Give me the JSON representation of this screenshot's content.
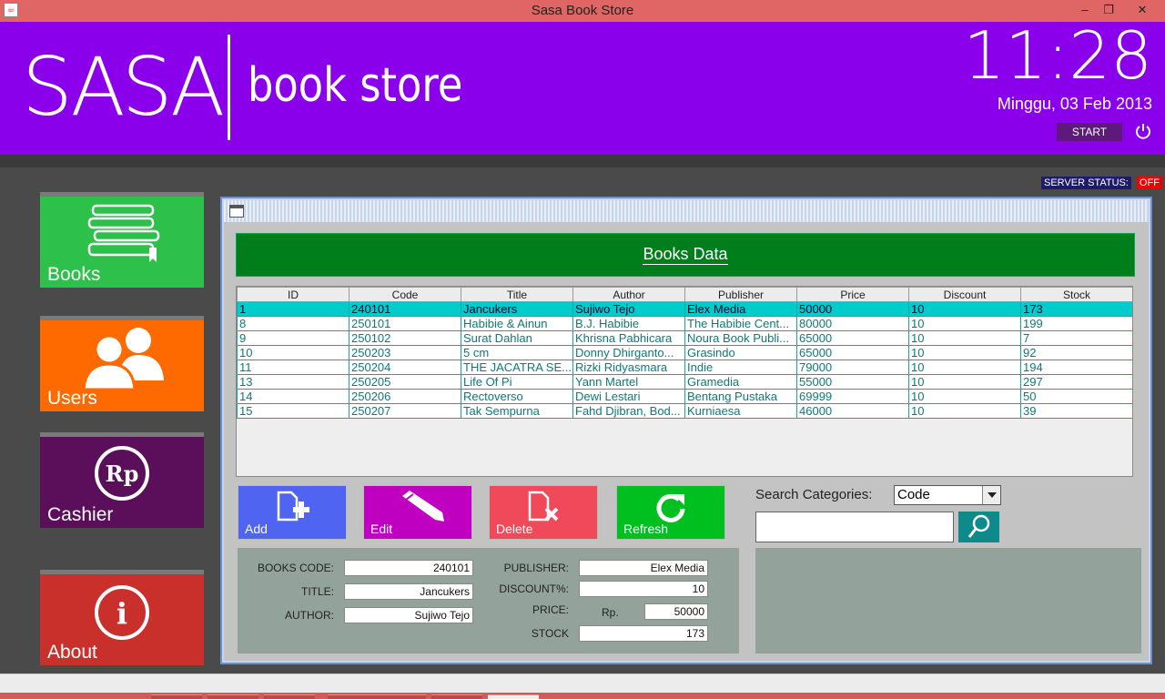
{
  "window": {
    "title": "Sasa Book Store",
    "controls": [
      "–",
      "❐",
      "✕"
    ]
  },
  "header": {
    "logo_main": "SASA",
    "logo_sub": "book store",
    "clock": "11:28",
    "date": "Minggu, 03 Feb 2013",
    "start_label": "START"
  },
  "server": {
    "label": "SERVER STATUS:",
    "value": "OFF"
  },
  "sidebar": {
    "items": [
      {
        "label": "Books",
        "color": "#2dc04a"
      },
      {
        "label": "Users",
        "color": "#ff6a00"
      },
      {
        "label": "Cashier",
        "color": "#5b0f5b",
        "icon_text": "Rp"
      },
      {
        "label": "About",
        "color": "#c9302c",
        "icon_text": "i"
      }
    ]
  },
  "panel": {
    "title": "Books Data"
  },
  "table": {
    "columns": [
      "ID",
      "Code",
      "Title",
      "Author",
      "Publisher",
      "Price",
      "Discount",
      "Stock"
    ],
    "rows": [
      [
        "1",
        "240101",
        "Jancukers",
        "Sujiwo Tejo",
        "Elex Media",
        "50000",
        "10",
        "173"
      ],
      [
        "8",
        "250101",
        "Habibie & Ainun",
        "B.J. Habibie",
        "The Habibie Cent...",
        "80000",
        "10",
        "199"
      ],
      [
        "9",
        "250102",
        "Surat Dahlan",
        "Khrisna Pabhicara",
        "Noura Book Publi...",
        "65000",
        "10",
        "7"
      ],
      [
        "10",
        "250203",
        "5 cm",
        "Donny Dhirganto...",
        "Grasindo",
        "65000",
        "10",
        "92"
      ],
      [
        "11",
        "250204",
        "THE JACATRA SE...",
        "Rizki Ridyasmara",
        "Indie",
        "79000",
        "10",
        "194"
      ],
      [
        "13",
        "250205",
        "Life Of Pi",
        "Yann Martel",
        "Gramedia",
        "55000",
        "10",
        "297"
      ],
      [
        "14",
        "250206",
        "Rectoverso",
        "Dewi Lestari",
        "Bentang Pustaka",
        "69999",
        "10",
        "50"
      ],
      [
        "15",
        "250207",
        "Tak Sempurna",
        "Fahd Djibran, Bod...",
        "Kurniaesa",
        "46000",
        "10",
        "39"
      ]
    ]
  },
  "actions": {
    "add": "Add",
    "edit": "Edit",
    "delete": "Delete",
    "refresh": "Refresh"
  },
  "search": {
    "label": "Search Categories:",
    "selected": "Code",
    "value": ""
  },
  "form": {
    "code_label": "BOOKS CODE:",
    "code": "240101",
    "title_label": "TITLE:",
    "title": "Jancukers",
    "author_label": "AUTHOR:",
    "author": "Sujiwo Tejo",
    "publisher_label": "PUBLISHER:",
    "publisher": "Elex Media",
    "discount_label": "DISCOUNT%:",
    "discount": "10",
    "price_label": "PRICE:",
    "price_prefix": "Rp.",
    "price": "50000",
    "stock_label": "STOCK",
    "stock": "173"
  }
}
